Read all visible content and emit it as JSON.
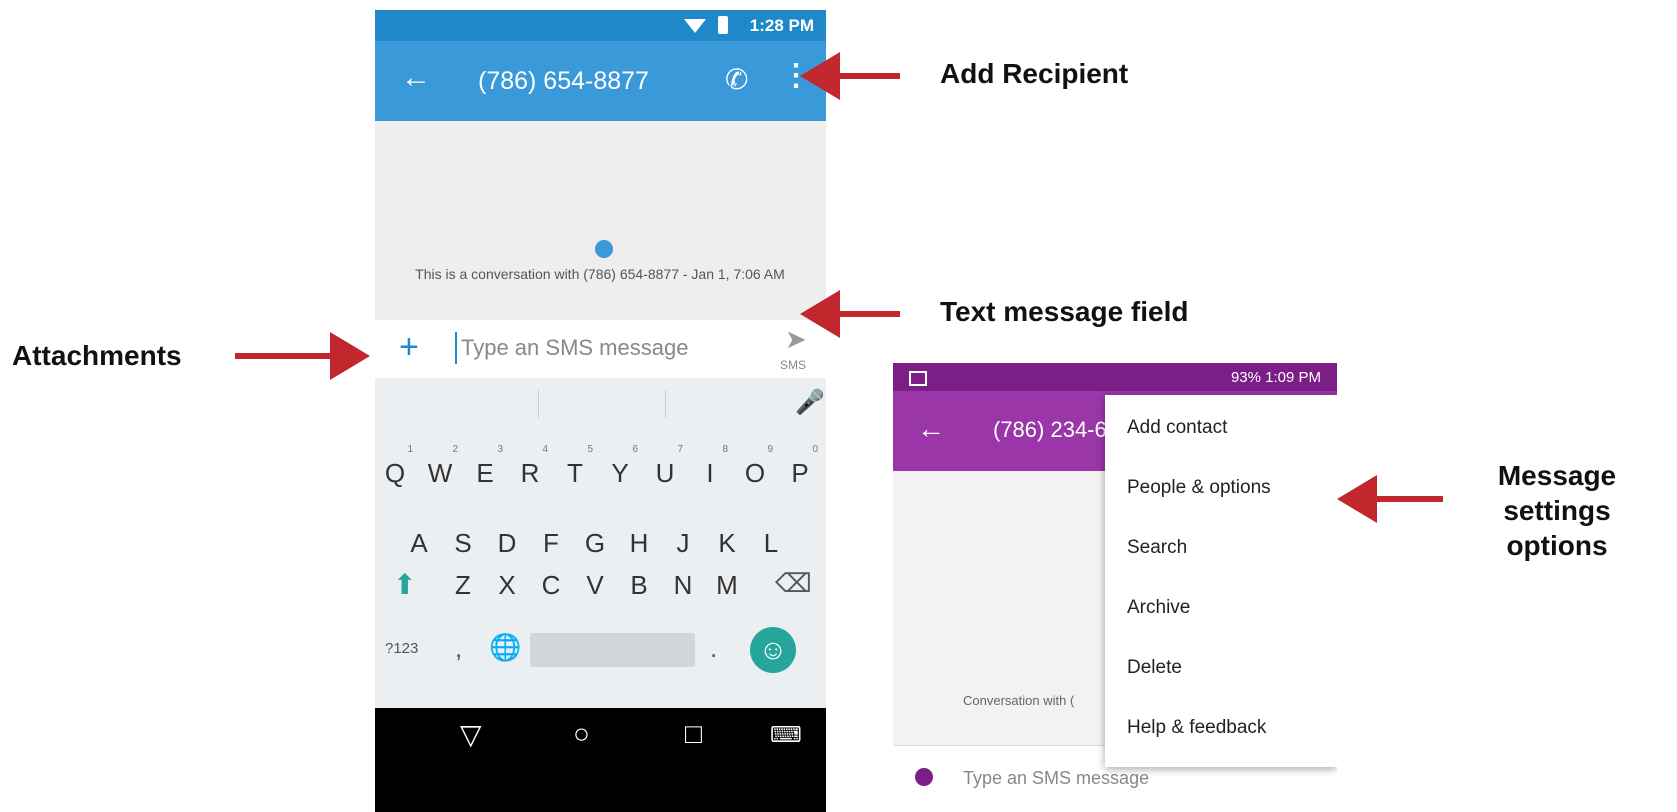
{
  "phone1": {
    "status_time": "1:28 PM",
    "title": "(786) 654-8877",
    "conversation_info": "This is a conversation with (786) 654-8877 - Jan 1, 7:06 AM",
    "input_placeholder": "Type an SMS message",
    "send_label": "SMS",
    "keyboard": {
      "row1": [
        "Q",
        "W",
        "E",
        "R",
        "T",
        "Y",
        "U",
        "I",
        "O",
        "P"
      ],
      "row1_hints": [
        "1",
        "2",
        "3",
        "4",
        "5",
        "6",
        "7",
        "8",
        "9",
        "0"
      ],
      "row2": [
        "A",
        "S",
        "D",
        "F",
        "G",
        "H",
        "J",
        "K",
        "L"
      ],
      "row3": [
        "Z",
        "X",
        "C",
        "V",
        "B",
        "N",
        "M"
      ],
      "symbols_key": "?123",
      "comma": ",",
      "period": "."
    }
  },
  "phone2": {
    "status_text": "93% 1:09 PM",
    "title": "(786) 234-6",
    "conversation_info": "Conversation with (",
    "input_placeholder": "Type an SMS message",
    "menu": [
      "Add contact",
      "People & options",
      "Search",
      "Archive",
      "Delete",
      "Help & feedback"
    ]
  },
  "annotations": {
    "add_recipient": "Add Recipient",
    "text_message_field": "Text message field",
    "attachments": "Attachments",
    "message_settings": "Message settings options"
  },
  "colors": {
    "phone1_accent": "#3a9ad9",
    "phone2_accent": "#9b36a8",
    "arrow": "#c1272d",
    "keyboard_accent": "#26a69a"
  }
}
